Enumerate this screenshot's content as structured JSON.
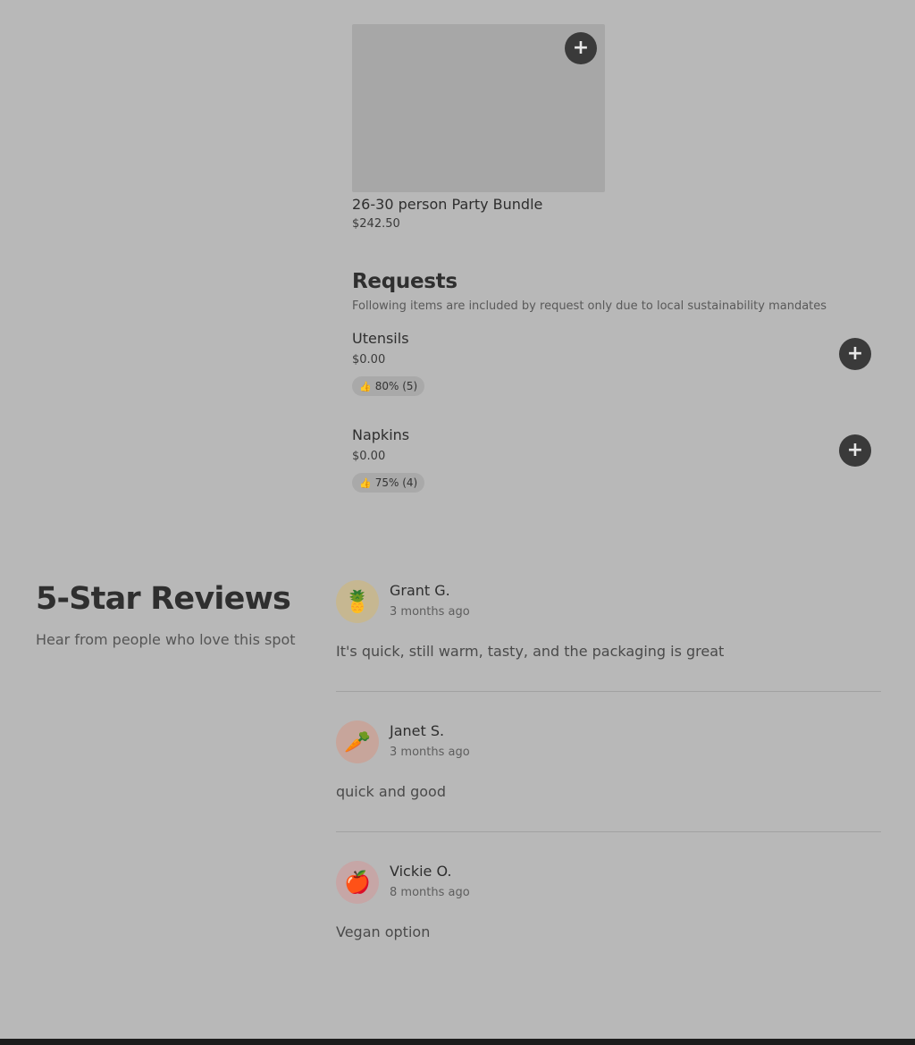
{
  "product": {
    "name": "26-30 person Party Bundle",
    "price": "$242.50",
    "add_icon": "plus-icon"
  },
  "requests": {
    "title": "Requests",
    "subtitle": "Following items are included by request only due to local sustainability mandates",
    "items": [
      {
        "name": "Utensils",
        "price": "$0.00",
        "rating": "80% (5)",
        "rating_icon": "thumbs-up-icon"
      },
      {
        "name": "Napkins",
        "price": "$0.00",
        "rating": "75% (4)",
        "rating_icon": "thumbs-up-icon"
      }
    ]
  },
  "reviews": {
    "title": "5-Star Reviews",
    "subtitle": "Hear from people who love this spot",
    "items": [
      {
        "name": "Grant G.",
        "time": "3 months ago",
        "text": "It's quick, still warm, tasty, and the packaging is great",
        "avatar": "pineapple-icon",
        "avatar_color": "#c6b791"
      },
      {
        "name": "Janet S.",
        "time": "3 months ago",
        "text": "quick and good",
        "avatar": "carrot-icon",
        "avatar_color": "#c7a59b"
      },
      {
        "name": "Vickie O.",
        "time": "8 months ago",
        "text": "Vegan option",
        "avatar": "apple-icon",
        "avatar_color": "#c6a6a6"
      }
    ]
  },
  "glyphs": {
    "plus": "+",
    "thumb": "👍",
    "pineapple": "🍍",
    "carrot": "🥕",
    "apple": "🍎"
  }
}
